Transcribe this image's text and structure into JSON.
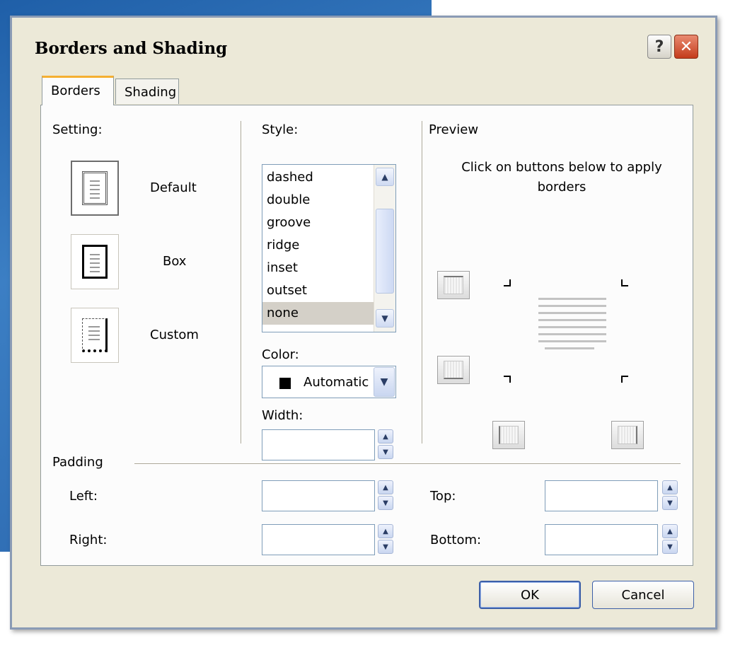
{
  "dialog": {
    "title": "Borders and Shading"
  },
  "titlebar": {
    "help_label": "?",
    "close_label": "✕"
  },
  "tabs": [
    {
      "label": "Borders",
      "active": true
    },
    {
      "label": "Shading",
      "active": false
    }
  ],
  "setting": {
    "label": "Setting:",
    "options": [
      {
        "label": "Default",
        "icon": "page-default-icon"
      },
      {
        "label": "Box",
        "icon": "page-box-icon"
      },
      {
        "label": "Custom",
        "icon": "page-custom-icon"
      }
    ]
  },
  "style": {
    "label": "Style:",
    "items": [
      "dashed",
      "double",
      "groove",
      "ridge",
      "inset",
      "outset",
      "none"
    ],
    "selected": "none",
    "scroll_up": "▲",
    "scroll_down": "▼"
  },
  "color": {
    "label": "Color:",
    "value": "Automatic",
    "swatch": "#000000",
    "dropdown": "▼"
  },
  "width": {
    "label": "Width:",
    "value": ""
  },
  "preview": {
    "label": "Preview",
    "hint": "Click on buttons below to apply borders"
  },
  "padding": {
    "label": "Padding",
    "left_label": "Left:",
    "right_label": "Right:",
    "top_label": "Top:",
    "bottom_label": "Bottom:",
    "left_value": "",
    "right_value": "",
    "top_value": "",
    "bottom_value": ""
  },
  "buttons": {
    "ok": "OK",
    "cancel": "Cancel"
  },
  "spin": {
    "up": "▲",
    "down": "▼"
  },
  "colors": {
    "dialog_bg": "#ece9d8",
    "pane_bg": "#fcfcfc",
    "tab_accent": "#f5b032",
    "close_button": "#c43c1c",
    "button_border": "#3c5fa8",
    "selection": "#d4d0c8"
  }
}
